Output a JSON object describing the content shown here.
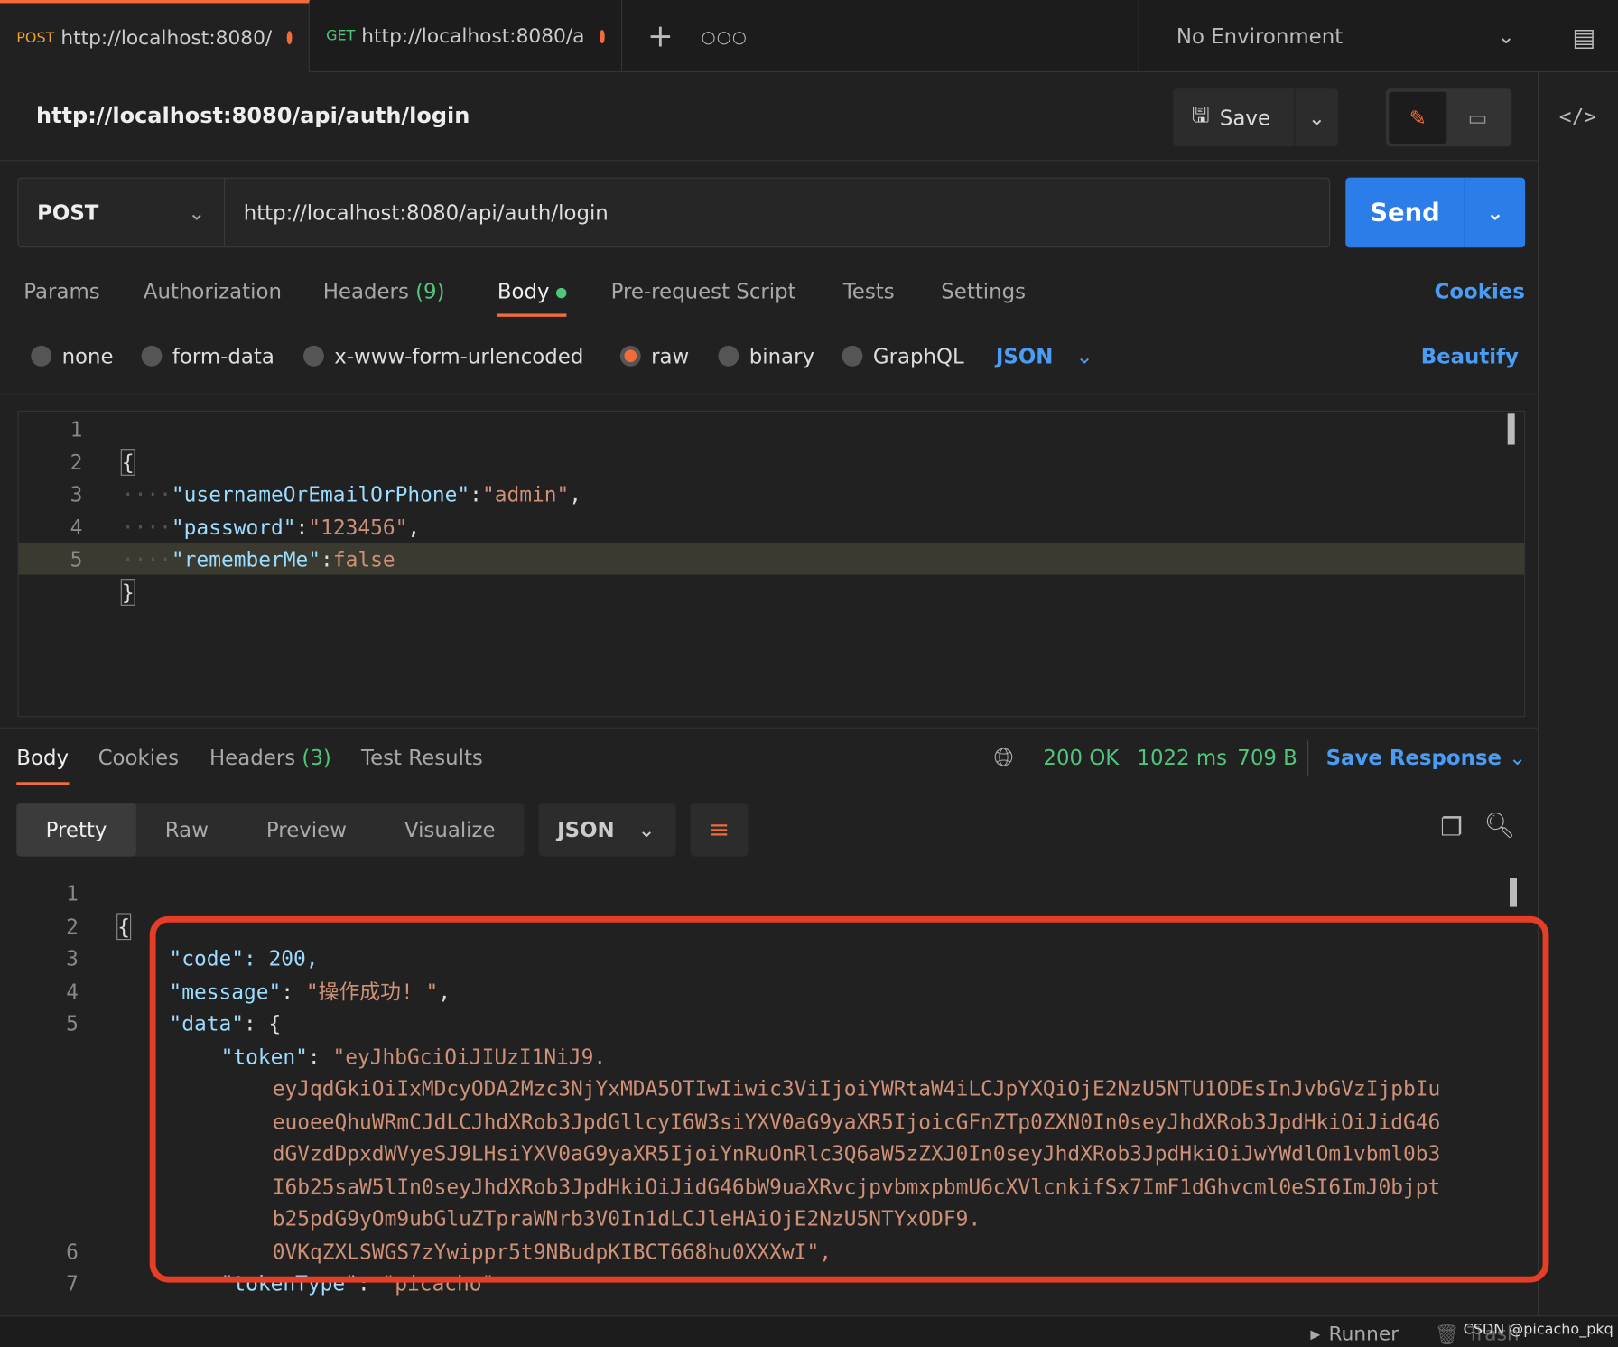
{
  "tabs": [
    {
      "method": "POST",
      "url": "http://localhost:8080/",
      "color": "#f0a030"
    },
    {
      "method": "GET",
      "url": "http://localhost:8080/a",
      "color": "#4fc77a"
    }
  ],
  "environment": "No Environment",
  "request": {
    "title": "http://localhost:8080/api/auth/login",
    "method": "POST",
    "url": "http://localhost:8080/api/auth/login",
    "save": "Save",
    "send": "Send"
  },
  "request_tabs": {
    "params": "Params",
    "authorization": "Authorization",
    "headers": "Headers",
    "headers_count": "(9)",
    "body": "Body",
    "prerequest": "Pre-request Script",
    "tests": "Tests",
    "settings": "Settings",
    "cookies": "Cookies"
  },
  "body_types": {
    "none": "none",
    "form_data": "form-data",
    "urlencoded": "x-www-form-urlencoded",
    "raw": "raw",
    "binary": "binary",
    "graphql": "GraphQL",
    "format": "JSON",
    "beautify": "Beautify"
  },
  "request_body": {
    "l1": "{",
    "l2k": "\"usernameOrEmailOrPhone\"",
    "l2v": "\"admin\"",
    "l3k": "\"password\"",
    "l3v": "\"123456\"",
    "l4k": "\"rememberMe\"",
    "l4v": "false",
    "l5": "}"
  },
  "response_tabs": {
    "body": "Body",
    "cookies": "Cookies",
    "headers": "Headers",
    "headers_count": "(3)",
    "tests": "Test Results"
  },
  "status": {
    "code": "200 OK",
    "time": "1022 ms",
    "size": "709 B",
    "save_response": "Save Response"
  },
  "view_modes": {
    "pretty": "Pretty",
    "raw": "Raw",
    "preview": "Preview",
    "visualize": "Visualize",
    "format": "JSON"
  },
  "response_body": {
    "l1": "{",
    "code_line": "\"code\": 200,",
    "message_k": "\"message\"",
    "message_v": "\"操作成功! \"",
    "data_k": "\"data\"",
    "token_k": "\"token\"",
    "token_lines": [
      "\"eyJhbGciOiJIUzI1NiJ9.",
      "eyJqdGkiOiIxMDcyODA2Mzc3NjYxMDA5OTIwIiwic3ViIjoiYWRtaW4iLCJpYXQiOjE2NzU5NTU1ODEsInJvbGVzIjpbIu",
      "euoeeQhuWRmCJdLCJhdXRob3JpdGllcyI6W3siYXV0aG9yaXR5IjoicGFnZTp0ZXN0In0seyJhdXRob3JpdHkiOiJidG46",
      "dGVzdDpxdWVyeSJ9LHsiYXV0aG9yaXR5IjoiYnRuOnRlc3Q6aW5zZXJ0In0seyJhdXRob3JpdHkiOiJwYWdlOm1vbml0b3",
      "I6b25saW5lIn0seyJhdXRob3JpdHkiOiJidG46bW9uaXRvcjpvbmxpbmU6cXVlcnkifSx7ImF1dGhvcml0eSI6ImJ0bjpt",
      "b25pdG9yOm9ubGluZTpraWNrb3V0In1dLCJleHAiOjE2NzU5NTYxODF9.",
      "0VKqZXLSWGS7zYwippr5t9NBudpKIBCT668hu0XXXwI\","
    ],
    "tokentype_k": "\"tokenType\"",
    "tokentype_v": "\"picacho\"",
    "l7": "}"
  },
  "footer": {
    "runner": "Runner",
    "trash": "Trash",
    "watermark": "CSDN @picacho_pkq"
  },
  "colors": {
    "accent": "#f26b3a",
    "send": "#2b7de9",
    "highlight_box": "#e63d26"
  }
}
